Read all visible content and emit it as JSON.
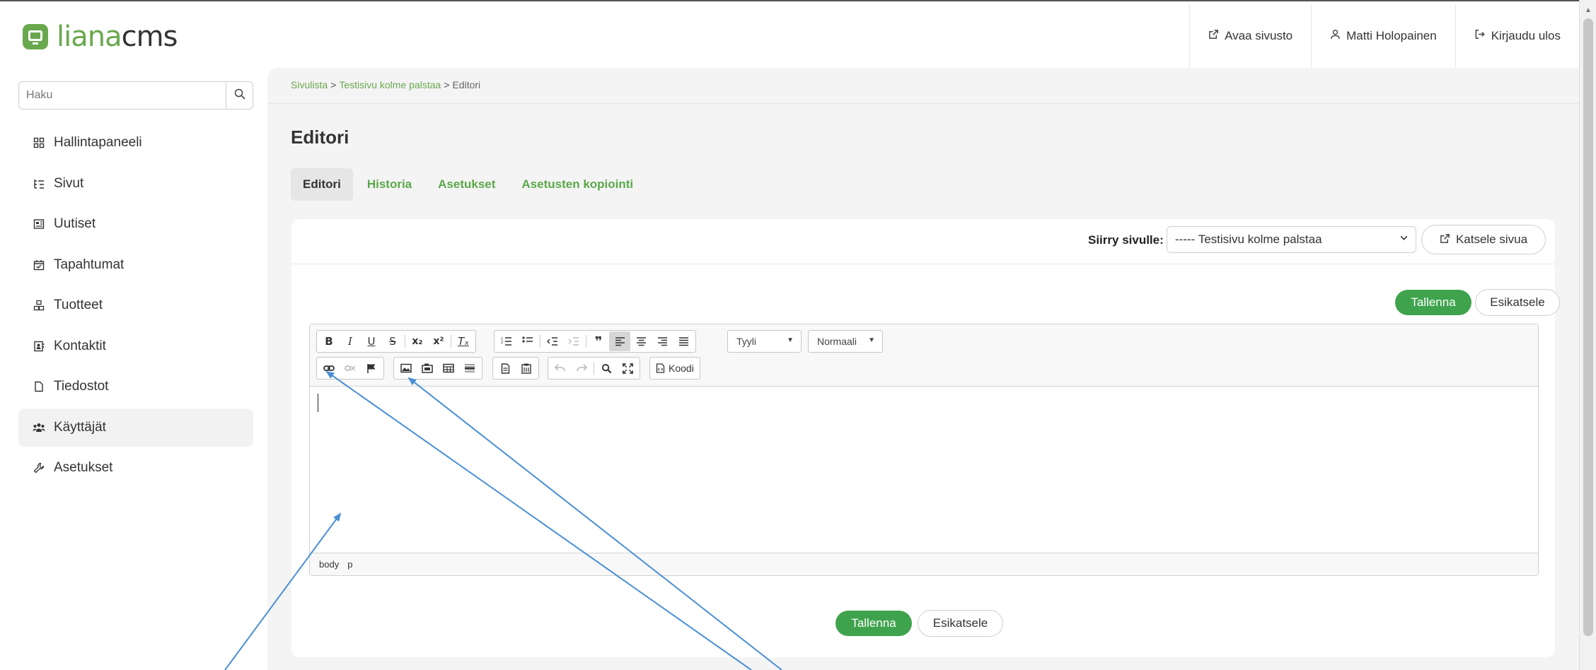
{
  "header": {
    "logo_part1": "liana",
    "logo_part2": "cms",
    "links": [
      {
        "icon": "external-link-icon",
        "label": "Avaa sivusto"
      },
      {
        "icon": "user-icon",
        "label": "Matti Holopainen"
      },
      {
        "icon": "logout-icon",
        "label": "Kirjaudu ulos"
      }
    ]
  },
  "sidebar": {
    "search_placeholder": "Haku",
    "items": [
      {
        "icon": "dashboard-icon",
        "label": "Hallintapaneeli"
      },
      {
        "icon": "pages-icon",
        "label": "Sivut"
      },
      {
        "icon": "news-icon",
        "label": "Uutiset"
      },
      {
        "icon": "calendar-icon",
        "label": "Tapahtumat"
      },
      {
        "icon": "products-icon",
        "label": "Tuotteet"
      },
      {
        "icon": "contacts-icon",
        "label": "Kontaktit"
      },
      {
        "icon": "file-icon",
        "label": "Tiedostot"
      },
      {
        "icon": "users-icon",
        "label": "Käyttäjät",
        "active": true
      },
      {
        "icon": "wrench-icon",
        "label": "Asetukset"
      }
    ]
  },
  "main": {
    "breadcrumb": [
      "Sivulista",
      "Testisivu kolme palstaa",
      "Editori"
    ],
    "breadcrumb_sep": ">",
    "title": "Editori",
    "tabs": [
      {
        "label": "Editori",
        "active": true
      },
      {
        "label": "Historia"
      },
      {
        "label": "Asetukset"
      },
      {
        "label": "Asetusten kopiointi"
      }
    ],
    "goto_label": "Siirry sivulle:",
    "goto_value": "----- Testisivu kolme palstaa",
    "view_page_label": "Katsele sivua",
    "save_label": "Tallenna",
    "preview_label": "Esikatsele"
  },
  "editor": {
    "style_combo": "Tyyli",
    "format_combo": "Normaali",
    "source_label": "Koodi",
    "path": [
      "body",
      "p"
    ]
  },
  "colors": {
    "brand_green": "#6aa84f",
    "button_green": "#3fa34d",
    "link_green": "#5aa84a",
    "annotation_blue": "#4a8fd4"
  }
}
